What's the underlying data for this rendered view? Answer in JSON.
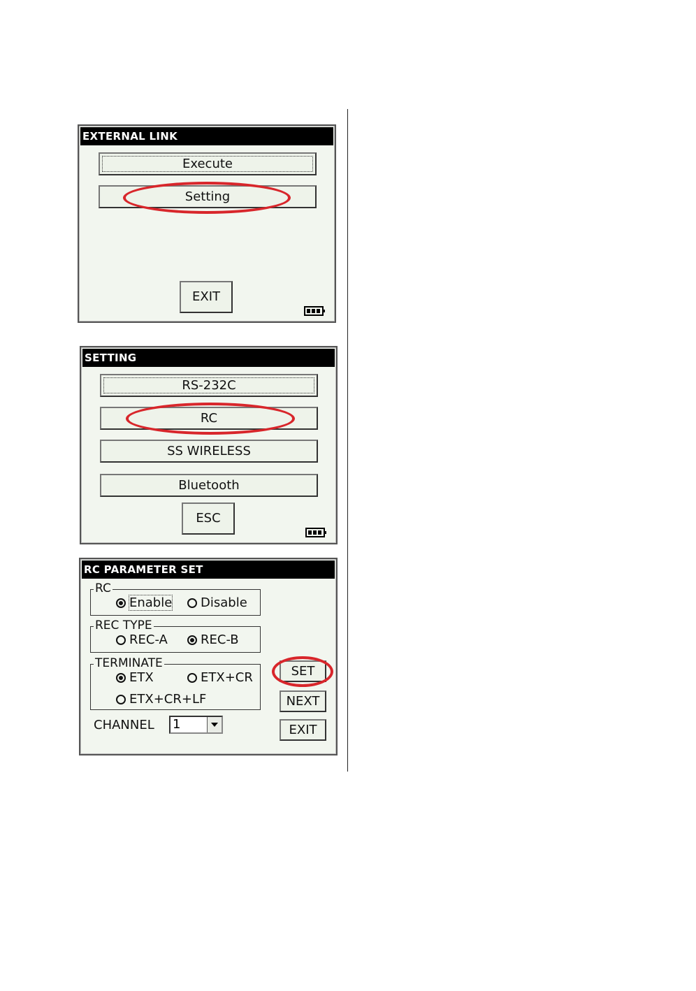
{
  "screens": {
    "external_link": {
      "title": "EXTERNAL LINK",
      "execute_label": "Execute",
      "setting_label": "Setting",
      "exit_label": "EXIT"
    },
    "setting": {
      "title": "SETTING",
      "rs232c_label": "RS-232C",
      "rc_label": "RC",
      "ss_wireless_label": "SS WIRELESS",
      "bluetooth_label": "Bluetooth",
      "esc_label": "ESC"
    },
    "rc_parameter_set": {
      "title": "RC PARAMETER SET",
      "rc_group": {
        "label": "RC",
        "options": [
          {
            "label": "Enable",
            "selected": true
          },
          {
            "label": "Disable",
            "selected": false
          }
        ]
      },
      "rec_type_group": {
        "label": "REC TYPE",
        "options": [
          {
            "label": "REC-A",
            "selected": false
          },
          {
            "label": "REC-B",
            "selected": true
          }
        ]
      },
      "terminate_group": {
        "label": "TERMINATE",
        "options": [
          {
            "label": "ETX",
            "selected": true
          },
          {
            "label": "ETX+CR",
            "selected": false
          },
          {
            "label": "ETX+CR+LF",
            "selected": false
          }
        ]
      },
      "channel_label": "CHANNEL",
      "channel_value": "1",
      "set_label": "SET",
      "next_label": "NEXT",
      "exit_label": "EXIT"
    }
  },
  "colors": {
    "highlight": "#d8262b",
    "titlebar": "#000000",
    "window_bg": "#f2f6ef"
  },
  "icons": [
    "battery-icon",
    "dropdown-arrow-icon",
    "radio-icon"
  ]
}
